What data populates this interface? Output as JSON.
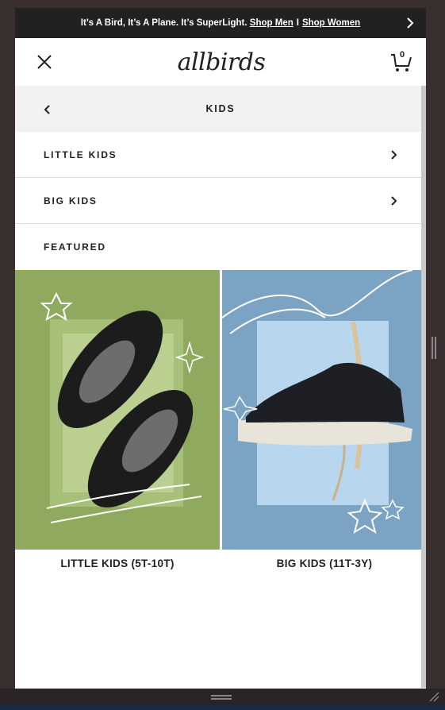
{
  "promo": {
    "text": "It’s A Bird, It’s A Plane. It’s SuperLight.",
    "link_men": "Shop Men",
    "separator": "I",
    "link_women": "Shop Women"
  },
  "header": {
    "logo": "allbirds",
    "icons": {
      "close": "close-icon",
      "cart": "cart-icon"
    },
    "cart_count": "0"
  },
  "subnav": {
    "title": "KIDS"
  },
  "menu": {
    "items": [
      {
        "label": "LITTLE KIDS"
      },
      {
        "label": "BIG KIDS"
      }
    ],
    "featured_label": "FEATURED"
  },
  "cards": [
    {
      "label": "LITTLE KIDS (5T-10T)",
      "bg": "#8faa5e"
    },
    {
      "label": "BIG KIDS (11T-3Y)",
      "bg": "#7aa3c4"
    }
  ],
  "colors": {
    "promo_bg": "#212121",
    "text": "#212121",
    "subnav_bg": "#f2f2f2"
  }
}
